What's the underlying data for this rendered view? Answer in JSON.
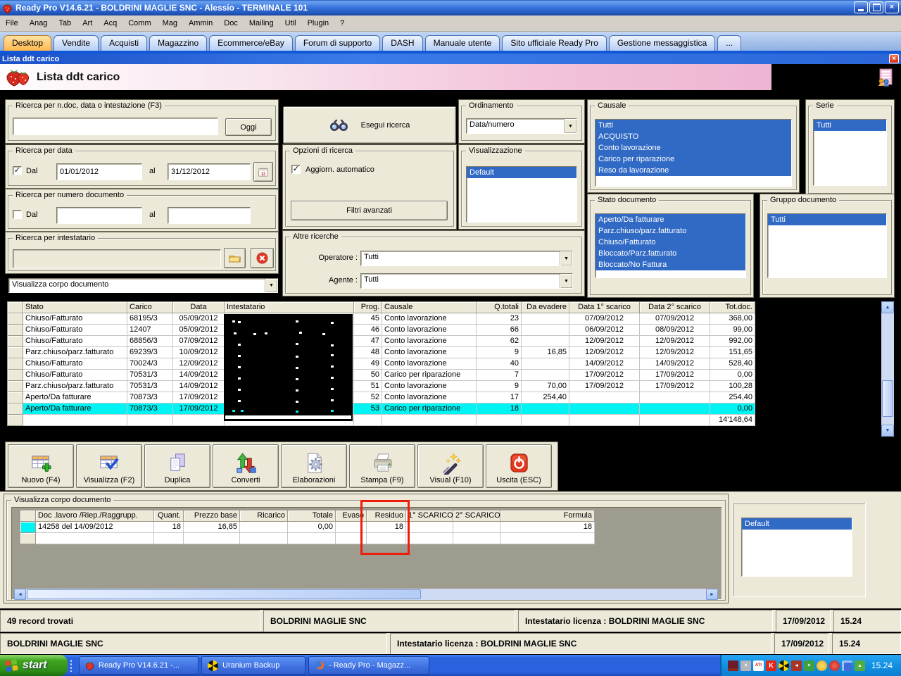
{
  "window": {
    "title": "Ready Pro V14.6.21 - BOLDRINI MAGLIE SNC - Alessio - TERMINALE 101",
    "app_icon": "strawberry-icon"
  },
  "menu": {
    "items": [
      "File",
      "Anag",
      "Tab",
      "Art",
      "Acq",
      "Comm",
      "Mag",
      "Ammin",
      "Doc",
      "Mailing",
      "Util",
      "Plugin",
      "?"
    ]
  },
  "tabs": {
    "active": "Desktop",
    "items": [
      "Desktop",
      "Vendite",
      "Acquisti",
      "Magazzino",
      "Ecommerce/eBay",
      "Forum di supporto",
      "DASH",
      "Manuale utente",
      "Sito ufficiale Ready Pro",
      "Gestione messaggistica",
      "..."
    ]
  },
  "inner_window": {
    "title": "Lista ddt carico",
    "close_glyph": "×"
  },
  "header": {
    "title": "Lista ddt carico",
    "icon": "strawberries-icon",
    "right_icon": "document-users-icon"
  },
  "filters": {
    "search_group": {
      "label": "Ricerca per n.doc, data o intestazione (F3)",
      "value": "",
      "today_button": "Oggi"
    },
    "date_group": {
      "label": "Ricerca per data",
      "checkbox": "Dal",
      "checked": true,
      "from": "01/01/2012",
      "al": "al",
      "to": "31/12/2012",
      "calendar_icon": "calendar-12-icon"
    },
    "number_group": {
      "label": "Ricerca per numero documento",
      "checkbox": "Dal",
      "checked": false,
      "from": "",
      "al": "al",
      "to": ""
    },
    "intestatario_group": {
      "label": "Ricerca per intestatario",
      "value": "",
      "folder_icon": "folder-icon",
      "cancel_icon": "cancel-x-icon"
    },
    "corpo_combo_value": "Visualizza corpo documento",
    "search_button": "Esegui ricerca",
    "search_button_icon": "binoculars-icon",
    "options_group": {
      "label": "Opzioni di ricerca",
      "checkbox": "Aggiorn. automatico",
      "checked": true,
      "advanced_button": "Filtri avanzati"
    },
    "altre_group": {
      "label": "Altre ricerche",
      "operatore_label": "Operatore :",
      "operatore_value": "Tutti",
      "agente_label": "Agente :",
      "agente_value": "Tutti"
    },
    "ordinamento": {
      "label": "Ordinamento",
      "value": "Data/numero"
    },
    "visualizzazione": {
      "label": "Visualizzazione",
      "items": [
        "Default"
      ],
      "selected": [
        0
      ]
    },
    "causale": {
      "label": "Causale",
      "items": [
        "Tutti",
        "ACQUISTO",
        "Conto lavorazione",
        "Carico  per riparazione",
        "Reso da lavorazione"
      ],
      "all_selected": true
    },
    "serie": {
      "label": "Serie",
      "items": [
        "Tutti"
      ],
      "selected": [
        0
      ]
    },
    "stato_documento": {
      "label": "Stato documento",
      "items": [
        "Aperto/Da fatturare",
        "Parz.chiuso/parz.fatturato",
        "Chiuso/Fatturato",
        "Bloccato/Parz.fatturato",
        "Bloccato/No Fattura"
      ],
      "all_selected": true
    },
    "gruppo_documento": {
      "label": "Gruppo documento",
      "items": [
        "Tutti"
      ],
      "selected": [
        0
      ]
    }
  },
  "grid": {
    "columns": [
      "",
      "Stato",
      "Carico",
      "Data",
      "Intestatario",
      "Prog.",
      "Causale",
      "Q.totali",
      "Da evadere",
      "Data 1° scarico",
      "Data 2° scarico",
      "Tot.doc."
    ],
    "intestatario_redacted": true,
    "selected_index": 8,
    "rows": [
      [
        "Chiuso/Fatturato",
        "68195/3",
        "05/09/2012",
        "",
        "45",
        "Conto lavorazione",
        "23",
        "",
        "07/09/2012",
        "07/09/2012",
        "368,00"
      ],
      [
        "Chiuso/Fatturato",
        "12407",
        "05/09/2012",
        "",
        "46",
        "Conto lavorazione",
        "66",
        "",
        "06/09/2012",
        "08/09/2012",
        "99,00"
      ],
      [
        "Chiuso/Fatturato",
        "68856/3",
        "07/09/2012",
        "",
        "47",
        "Conto lavorazione",
        "62",
        "",
        "12/09/2012",
        "12/09/2012",
        "992,00"
      ],
      [
        "Parz.chiuso/parz.fatturato",
        "69239/3",
        "10/09/2012",
        "",
        "48",
        "Conto lavorazione",
        "9",
        "16,85",
        "12/09/2012",
        "12/09/2012",
        "151,65"
      ],
      [
        "Chiuso/Fatturato",
        "70024/3",
        "12/09/2012",
        "",
        "49",
        "Conto lavorazione",
        "40",
        "",
        "14/09/2012",
        "14/09/2012",
        "528,40"
      ],
      [
        "Chiuso/Fatturato",
        "70531/3",
        "14/09/2012",
        "",
        "50",
        "Carico  per riparazione",
        "7",
        "",
        "17/09/2012",
        "17/09/2012",
        "0,00"
      ],
      [
        "Parz.chiuso/parz.fatturato",
        "70531/3",
        "14/09/2012",
        "",
        "51",
        "Conto lavorazione",
        "9",
        "70,00",
        "17/09/2012",
        "17/09/2012",
        "100,28"
      ],
      [
        "Aperto/Da fatturare",
        "70873/3",
        "17/09/2012",
        "",
        "52",
        "Conto lavorazione",
        "17",
        "254,40",
        "",
        "",
        "254,40"
      ],
      [
        "Aperto/Da fatturare",
        "70873/3",
        "17/09/2012",
        "",
        "53",
        "Carico  per riparazione",
        "18",
        "",
        "",
        "",
        "0,00"
      ],
      [
        "",
        "",
        "",
        "",
        "",
        "",
        "",
        "",
        "",
        "",
        "14'148,64"
      ]
    ]
  },
  "toolbar": {
    "buttons": [
      {
        "label": "Nuovo (F4)",
        "icon": "new-table-plus-icon"
      },
      {
        "label": "Visualizza (F2)",
        "icon": "view-table-check-icon"
      },
      {
        "label": "Duplica",
        "icon": "duplicate-pages-icon"
      },
      {
        "label": "Converti",
        "icon": "convert-arrows-icon"
      },
      {
        "label": "Elaborazioni",
        "icon": "process-gear-icon"
      },
      {
        "label": "Stampa (F9)",
        "icon": "printer-icon"
      },
      {
        "label": "Visual (F10)",
        "icon": "magic-wand-icon"
      },
      {
        "label": "Uscita (ESC)",
        "icon": "power-exit-icon"
      }
    ]
  },
  "corpo": {
    "label": "Visualizza corpo documento",
    "columns": [
      "",
      "Doc .lavoro /Riep./Raggrupp.",
      "Quant.",
      "Prezzo base",
      "Ricarico",
      "Totale",
      "Evaso",
      "Residuo",
      "1° SCARICO",
      "2° SCARICO",
      "Formula"
    ],
    "selected_index": 0,
    "rows": [
      [
        "14258 del 14/09/2012",
        "18",
        "16,85",
        "",
        "0,00",
        "",
        "18",
        "",
        "",
        "18"
      ],
      [
        "",
        "",
        "",
        "",
        "",
        "",
        "",
        "",
        "",
        ""
      ]
    ],
    "annotation": {
      "column": "Residuo",
      "color": "#EE1C0C"
    },
    "side_list": {
      "items": [
        "Default"
      ],
      "selected": [
        0
      ]
    }
  },
  "status_bar_1": {
    "cells": [
      "49 record trovati",
      "BOLDRINI MAGLIE SNC",
      "Intestatario licenza : BOLDRINI MAGLIE SNC",
      "17/09/2012",
      "15.24"
    ]
  },
  "status_bar_2": {
    "cells": [
      "BOLDRINI MAGLIE SNC",
      "Intestatario licenza : BOLDRINI MAGLIE SNC",
      "17/09/2012",
      "15.24"
    ]
  },
  "taskbar": {
    "start_label": "start",
    "tasks": [
      {
        "label": "Ready Pro V14.6.21 -...",
        "icon": "strawberry-icon"
      },
      {
        "label": "Uranium Backup",
        "icon": "radiation-icon"
      },
      {
        "label": "- Ready Pro - Magazz...",
        "icon": "firefox-icon"
      }
    ],
    "tray_icons": [
      {
        "name": "password-key-icon",
        "text": ""
      },
      {
        "name": "inactive-gray-icon",
        "text": ""
      },
      {
        "name": "ati-icon",
        "text": "ATI"
      },
      {
        "name": "kaspersky-icon",
        "text": "K"
      },
      {
        "name": "uranium-backup-icon",
        "text": ""
      },
      {
        "name": "volume-icon",
        "text": ""
      },
      {
        "name": "messenger-offline-icon",
        "text": ""
      },
      {
        "name": "alarm-bell-icon",
        "text": ""
      },
      {
        "name": "red-app-icon",
        "text": ""
      },
      {
        "name": "network-icon",
        "text": ""
      },
      {
        "name": "usb-eject-icon",
        "text": ""
      }
    ],
    "clock": "15.24"
  },
  "colors": {
    "selection_blue": "#316AC5",
    "highlight_row_cyan": "#00F4F4",
    "active_tab_orange": "#FFB84D",
    "annotation_red": "#EE1C0C",
    "panel_beige": "#ECE9D8",
    "header_pink": "#EEB5D2"
  }
}
